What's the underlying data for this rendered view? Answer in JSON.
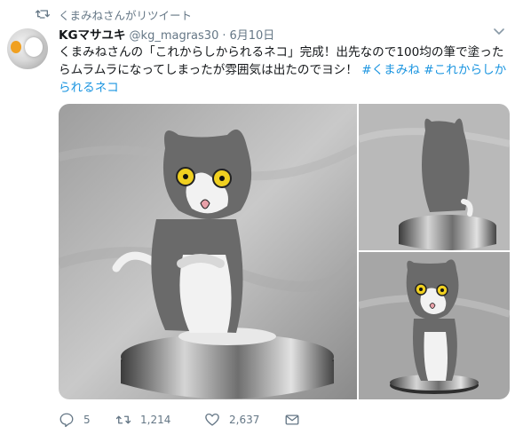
{
  "retweet": {
    "label": "くまみねさんがリツイート",
    "icon": "retweet-icon"
  },
  "author": {
    "name": "KGマサユキ",
    "handle": "@kg_magras30",
    "separator": "·",
    "date": "6月10日"
  },
  "tweet": {
    "text_plain": "くまみねさんの「これからしかられるネコ」完成！出先なので100均の筆で塗ったらムラムラになってしまったが雰囲気は出たのでヨシ！",
    "hashtags": [
      "#くまみね",
      "#これからしかられるネコ"
    ]
  },
  "media": {
    "photos": [
      {
        "subject": "gray-white-cat-figure-front"
      },
      {
        "subject": "gray-cat-figure-back"
      },
      {
        "subject": "gray-white-cat-figure-front-small"
      }
    ]
  },
  "actions": {
    "reply": {
      "count": "5",
      "icon": "reply-icon"
    },
    "retweet": {
      "count": "1,214",
      "icon": "retweet-icon"
    },
    "like": {
      "count": "2,637",
      "icon": "heart-icon"
    },
    "dm": {
      "icon": "envelope-icon"
    }
  },
  "colors": {
    "link": "#1b95e0",
    "muted": "#657786",
    "text": "#14171a"
  }
}
